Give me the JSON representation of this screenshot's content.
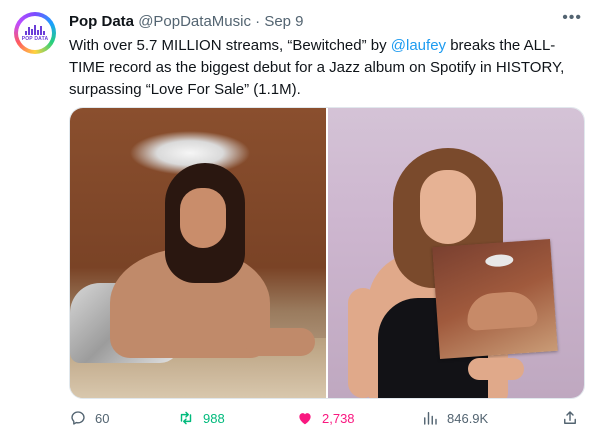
{
  "tweet": {
    "author_name": "Pop Data",
    "handle": "@PopDataMusic",
    "separator": "·",
    "date": "Sep 9",
    "text_before": "With over 5.7 MILLION streams, “Bewitched” by ",
    "mention": "@laufey",
    "text_after": " breaks the ALL-TIME record as the biggest debut for a Jazz album on Spotify in HISTORY, surpassing “Love For Sale” (1.1M).",
    "avatar_text": "POP DATA"
  },
  "actions": {
    "replies": "60",
    "retweets": "988",
    "likes": "2,738",
    "views": "846.9K"
  },
  "colors": {
    "mention": "#1d9bf0",
    "retweet_active": "#00ba7c",
    "like_active": "#f91880",
    "muted": "#536471"
  },
  "icons": [
    "more-icon",
    "reply-icon",
    "retweet-icon",
    "heart-icon",
    "views-icon",
    "share-icon"
  ]
}
